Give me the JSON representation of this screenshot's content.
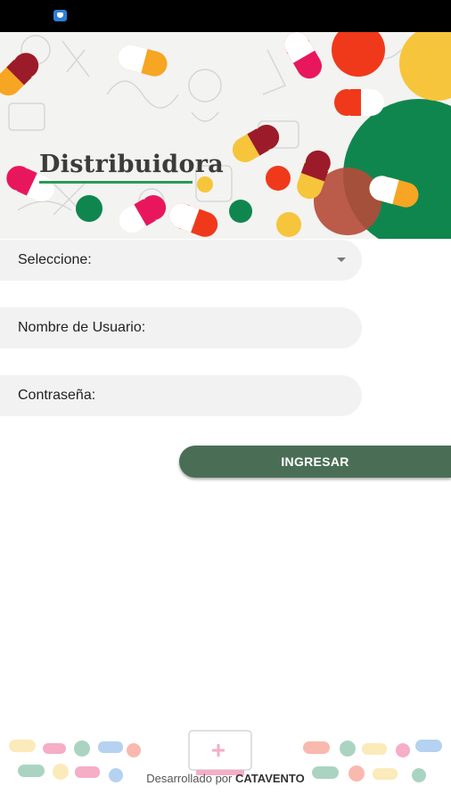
{
  "banner": {
    "brand": "Distribuidora",
    "colors": {
      "green": "#10864f",
      "red": "#f0391b",
      "yellow": "#f6c53b",
      "pink": "#e8175d"
    }
  },
  "form": {
    "select_label": "Seleccione:",
    "username_label": "Nombre de Usuario:",
    "password_label": "Contraseña:",
    "submit_label": "INGRESAR"
  },
  "footer": {
    "prefix": "Desarrollado por",
    "company": "CATAVENTO"
  },
  "icons": {
    "status_notification": "shield-notification-icon",
    "dropdown": "chevron-down-icon"
  }
}
